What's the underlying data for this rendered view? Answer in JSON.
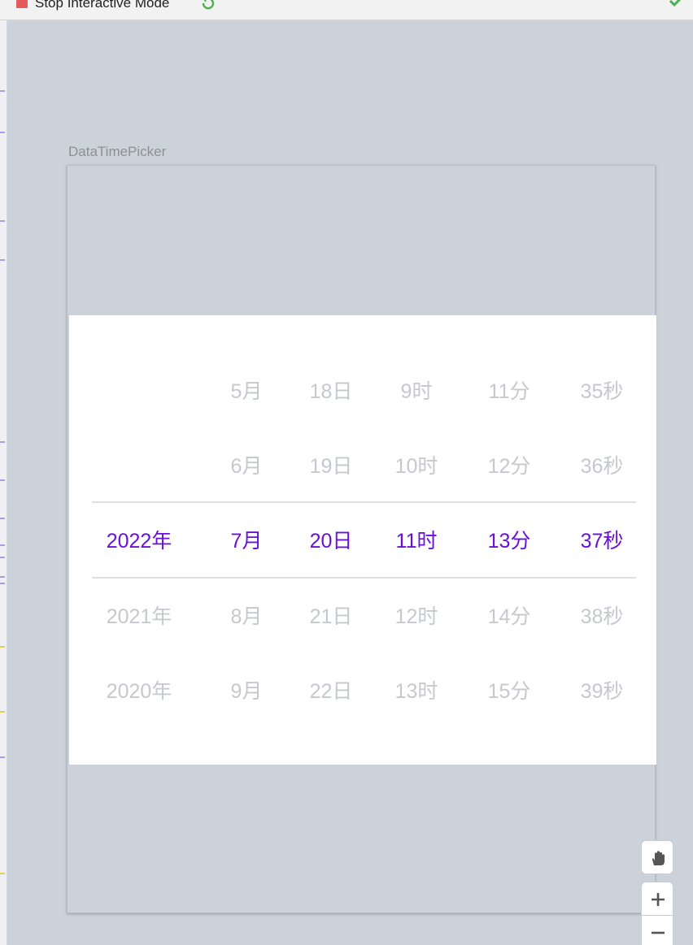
{
  "toolbar": {
    "stop_label": "Stop Interactive Mode",
    "icons": [
      "stop-icon",
      "refresh-icon",
      "checkmark-icon"
    ],
    "colors": {
      "stop": "#e25c5c",
      "refresh": "#4caf50",
      "check": "#4caf50"
    }
  },
  "preview": {
    "label": "DataTimePicker"
  },
  "picker": {
    "selected_color": "#6a10d8",
    "dim_color": "#c7c8cf",
    "columns": [
      {
        "name": "year",
        "items": [
          "",
          "",
          "2022年",
          "2021年",
          "2020年"
        ]
      },
      {
        "name": "month",
        "items": [
          "5月",
          "6月",
          "7月",
          "8月",
          "9月"
        ]
      },
      {
        "name": "day",
        "items": [
          "18日",
          "19日",
          "20日",
          "21日",
          "22日"
        ]
      },
      {
        "name": "hour",
        "items": [
          "9时",
          "10时",
          "11时",
          "12时",
          "13时"
        ]
      },
      {
        "name": "minute",
        "items": [
          "11分",
          "12分",
          "13分",
          "14分",
          "15分"
        ]
      },
      {
        "name": "second",
        "items": [
          "35秒",
          "36秒",
          "37秒",
          "38秒",
          "39秒"
        ]
      }
    ],
    "selected_index": 2
  },
  "zoom_controls": {
    "icons": [
      "hand-pan-icon",
      "zoom-in-icon",
      "zoom-out-icon"
    ]
  }
}
